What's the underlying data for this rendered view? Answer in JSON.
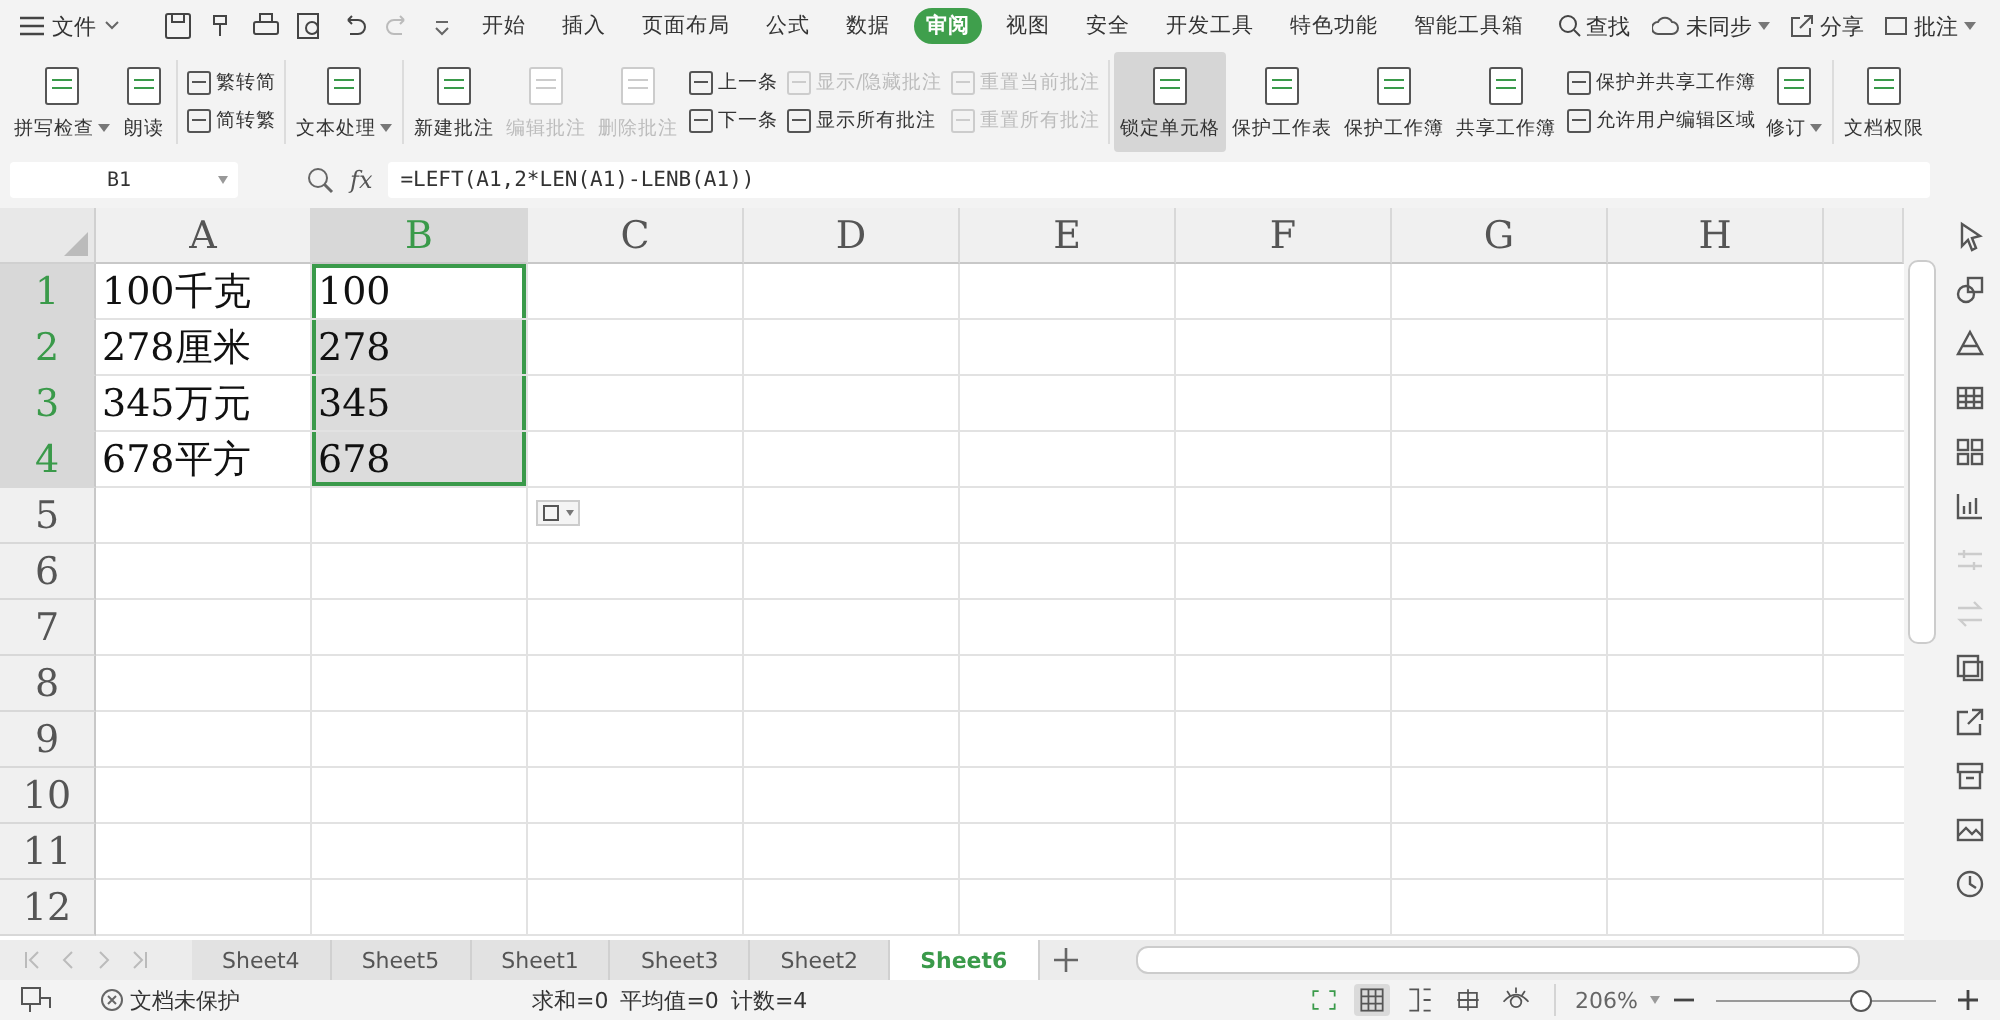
{
  "menu_bar": {
    "file_menu": "文件",
    "tabs": [
      {
        "label": "开始",
        "selected": false
      },
      {
        "label": "插入",
        "selected": false
      },
      {
        "label": "页面布局",
        "selected": false
      },
      {
        "label": "公式",
        "selected": false
      },
      {
        "label": "数据",
        "selected": false
      },
      {
        "label": "审阅",
        "selected": true
      },
      {
        "label": "视图",
        "selected": false
      },
      {
        "label": "安全",
        "selected": false
      },
      {
        "label": "开发工具",
        "selected": false
      },
      {
        "label": "特色功能",
        "selected": false
      },
      {
        "label": "智能工具箱",
        "selected": false
      }
    ],
    "search": "查找",
    "sync": "未同步",
    "share": "分享",
    "comment": "批注"
  },
  "ribbon": [
    {
      "kind": "large",
      "label": "拼写检查",
      "disabled": false,
      "pressed": false,
      "dropdown": true
    },
    {
      "kind": "large",
      "label": "朗读",
      "disabled": false,
      "pressed": false,
      "dropdown": false
    },
    {
      "kind": "separator"
    },
    {
      "kind": "stack",
      "items": [
        {
          "label": "繁转简",
          "disabled": false
        },
        {
          "label": "简转繁",
          "disabled": false
        }
      ]
    },
    {
      "kind": "separator"
    },
    {
      "kind": "large",
      "label": "文本处理",
      "disabled": false,
      "pressed": false,
      "dropdown": true
    },
    {
      "kind": "separator"
    },
    {
      "kind": "large",
      "label": "新建批注",
      "disabled": false,
      "pressed": false,
      "dropdown": false
    },
    {
      "kind": "large",
      "label": "编辑批注",
      "disabled": true,
      "pressed": false,
      "dropdown": false
    },
    {
      "kind": "large",
      "label": "删除批注",
      "disabled": true,
      "pressed": false,
      "dropdown": false
    },
    {
      "kind": "stack",
      "items": [
        {
          "label": "上一条",
          "disabled": false
        },
        {
          "label": "下一条",
          "disabled": false
        }
      ]
    },
    {
      "kind": "stack",
      "items": [
        {
          "label": "显示/隐藏批注",
          "disabled": true
        },
        {
          "label": "显示所有批注",
          "disabled": false
        }
      ]
    },
    {
      "kind": "stack",
      "items": [
        {
          "label": "重置当前批注",
          "disabled": true
        },
        {
          "label": "重置所有批注",
          "disabled": true
        }
      ]
    },
    {
      "kind": "separator"
    },
    {
      "kind": "large",
      "label": "锁定单元格",
      "disabled": false,
      "pressed": true,
      "dropdown": false
    },
    {
      "kind": "large",
      "label": "保护工作表",
      "disabled": false,
      "pressed": false,
      "dropdown": false
    },
    {
      "kind": "large",
      "label": "保护工作簿",
      "disabled": false,
      "pressed": false,
      "dropdown": false
    },
    {
      "kind": "large",
      "label": "共享工作簿",
      "disabled": false,
      "pressed": false,
      "dropdown": false
    },
    {
      "kind": "stack",
      "items": [
        {
          "label": "保护并共享工作簿",
          "disabled": false
        },
        {
          "label": "允许用户编辑区域",
          "disabled": false
        }
      ]
    },
    {
      "kind": "large",
      "label": "修订",
      "disabled": false,
      "pressed": false,
      "dropdown": true
    },
    {
      "kind": "separator"
    },
    {
      "kind": "large",
      "label": "文档权限",
      "disabled": false,
      "pressed": false,
      "dropdown": false
    }
  ],
  "formula_bar": {
    "name_box": "B1",
    "fx_label": "fx",
    "formula": "=LEFT(A1,2*LEN(A1)-LENB(A1))"
  },
  "columns": [
    {
      "label": "A",
      "selected": false
    },
    {
      "label": "B",
      "selected": true
    },
    {
      "label": "C",
      "selected": false
    },
    {
      "label": "D",
      "selected": false
    },
    {
      "label": "E",
      "selected": false
    },
    {
      "label": "F",
      "selected": false
    },
    {
      "label": "G",
      "selected": false
    },
    {
      "label": "H",
      "selected": false
    }
  ],
  "rows": [
    {
      "header": "1",
      "selected": true,
      "cells": [
        {
          "text": "100千克",
          "selected": false,
          "active": false
        },
        {
          "text": "100",
          "selected": true,
          "active": true
        }
      ]
    },
    {
      "header": "2",
      "selected": true,
      "cells": [
        {
          "text": "278厘米",
          "selected": false,
          "active": false
        },
        {
          "text": "278",
          "selected": true,
          "active": false
        }
      ]
    },
    {
      "header": "3",
      "selected": true,
      "cells": [
        {
          "text": "345万元",
          "selected": false,
          "active": false
        },
        {
          "text": "345",
          "selected": true,
          "active": false
        }
      ]
    },
    {
      "header": "4",
      "selected": true,
      "cells": [
        {
          "text": "678平方",
          "selected": false,
          "active": false
        },
        {
          "text": "678",
          "selected": true,
          "active": false
        }
      ]
    },
    {
      "header": "5",
      "selected": false
    },
    {
      "header": "6",
      "selected": false
    },
    {
      "header": "7",
      "selected": false
    },
    {
      "header": "8",
      "selected": false
    },
    {
      "header": "9",
      "selected": false
    },
    {
      "header": "10",
      "selected": false
    },
    {
      "header": "11",
      "selected": false
    },
    {
      "header": "12",
      "selected": false
    }
  ],
  "side_toolbar": [
    {
      "disabled": false
    },
    {
      "disabled": false
    },
    {
      "disabled": false
    },
    {
      "disabled": false
    },
    {
      "disabled": false
    },
    {
      "disabled": false
    },
    {
      "disabled": true
    },
    {
      "disabled": true
    },
    {
      "disabled": false
    },
    {
      "disabled": false
    },
    {
      "disabled": false
    },
    {
      "disabled": false
    },
    {
      "disabled": false
    }
  ],
  "sheet_tabs": [
    {
      "label": "Sheet4",
      "selected": false
    },
    {
      "label": "Sheet5",
      "selected": false
    },
    {
      "label": "Sheet1",
      "selected": false
    },
    {
      "label": "Sheet3",
      "selected": false
    },
    {
      "label": "Sheet2",
      "selected": false
    },
    {
      "label": "Sheet6",
      "selected": true
    }
  ],
  "status_bar": {
    "protection": "文档未保护",
    "sum": "求和=0",
    "average": "平均值=0",
    "count": "计数=4",
    "view_modes": [
      {
        "selected": false
      },
      {
        "selected": true
      },
      {
        "selected": false
      },
      {
        "selected": false
      },
      {
        "selected": false
      }
    ],
    "zoom": "206%",
    "zoom_slider": {
      "level": 0.66
    }
  }
}
